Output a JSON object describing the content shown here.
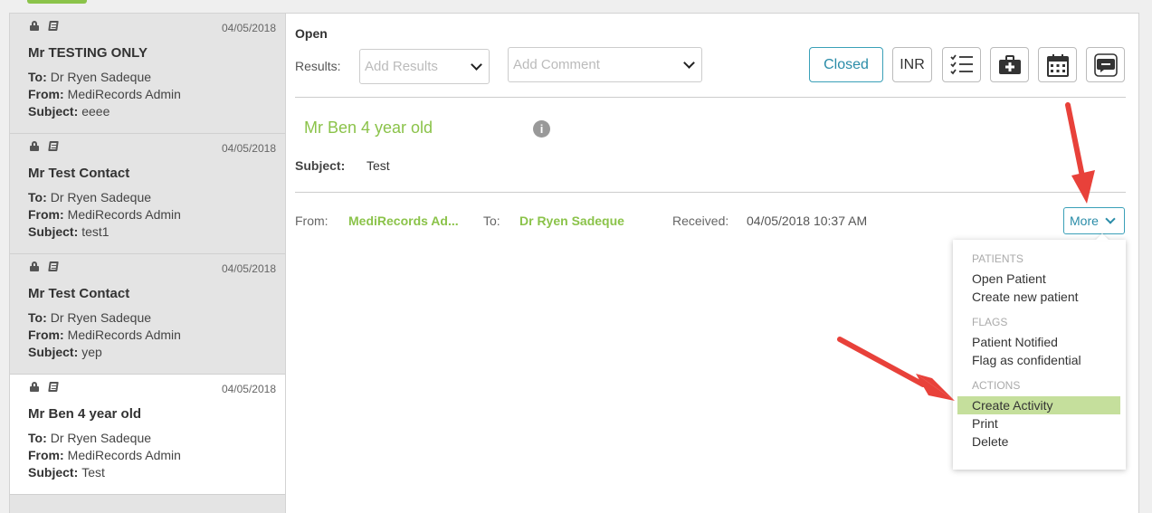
{
  "colors": {
    "accent_green": "#8bc34a",
    "accent_blue": "#2a8ca8",
    "highlight": "#c5df9c",
    "arrow": "#e8413a"
  },
  "messages": [
    {
      "date": "04/05/2018",
      "name": "Mr TESTING ONLY",
      "to_label": "To:",
      "to": "Dr Ryen Sadeque",
      "from_label": "From:",
      "from": "MediRecords Admin",
      "subject_label": "Subject:",
      "subject": "eeee"
    },
    {
      "date": "04/05/2018",
      "name": "Mr Test Contact",
      "to_label": "To:",
      "to": "Dr Ryen Sadeque",
      "from_label": "From:",
      "from": "MediRecords Admin",
      "subject_label": "Subject:",
      "subject": "test1"
    },
    {
      "date": "04/05/2018",
      "name": "Mr Test Contact",
      "to_label": "To:",
      "to": "Dr Ryen Sadeque",
      "from_label": "From:",
      "from": "MediRecords Admin",
      "subject_label": "Subject:",
      "subject": "yep"
    },
    {
      "date": "04/05/2018",
      "name": "Mr Ben 4 year old",
      "to_label": "To:",
      "to": "Dr Ryen Sadeque",
      "from_label": "From:",
      "from": "MediRecords Admin",
      "subject_label": "Subject:",
      "subject": "Test"
    }
  ],
  "detail": {
    "status_label": "Open",
    "results_label": "Results:",
    "results_placeholder": "Add Results",
    "comment_placeholder": "Add Comment",
    "closed_button": "Closed",
    "inr_button": "INR",
    "patient_name": "Mr Ben 4 year old",
    "info_glyph": "i",
    "subject_label": "Subject:",
    "subject": "Test",
    "from_label": "From:",
    "from": "MediRecords Ad...",
    "to_label": "To:",
    "to": "Dr Ryen Sadeque",
    "received_label": "Received:",
    "received": "04/05/2018 10:37 AM",
    "more_button": "More"
  },
  "toolbar_icons": [
    "checklist-icon",
    "medical-kit-icon",
    "calendar-icon",
    "sms-icon"
  ],
  "more_menu": {
    "patients_header": "PATIENTS",
    "open_patient": "Open Patient",
    "create_new_patient": "Create new patient",
    "flags_header": "FLAGS",
    "patient_notified": "Patient Notified",
    "flag_confidential": "Flag as confidential",
    "actions_header": "ACTIONS",
    "create_activity": "Create Activity",
    "print": "Print",
    "delete": "Delete"
  }
}
